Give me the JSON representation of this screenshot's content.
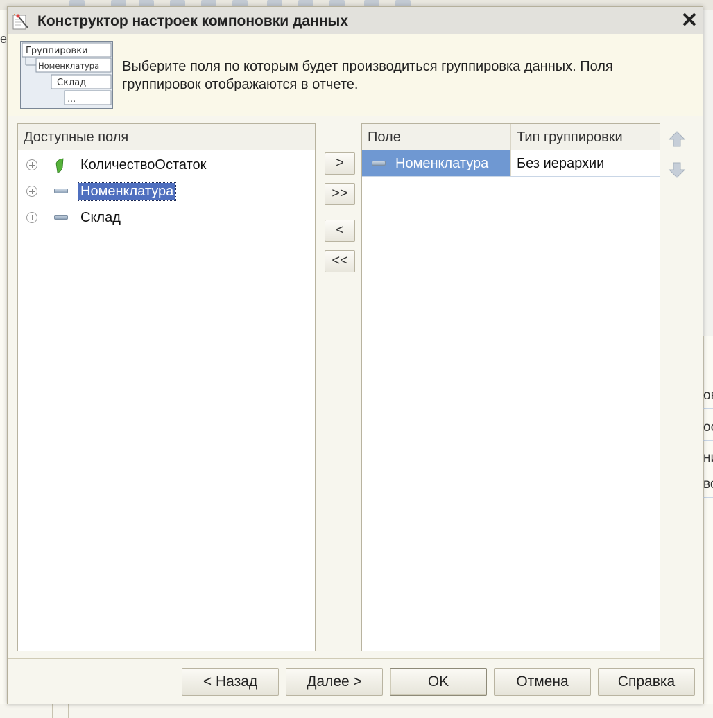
{
  "window": {
    "title": "Конструктор настроек компоновки данных",
    "close_icon": "close-icon"
  },
  "header": {
    "description": "Выберите поля по которым будет производиться группировка данных. Поля группировок отображаются в отчете.",
    "illustration": {
      "line1": "Группировки",
      "line2": "Номенклатура",
      "line3": "Склад",
      "line4": "..."
    }
  },
  "available_fields": {
    "header": "Доступные поля",
    "items": [
      {
        "label": "КоличествоОстаток",
        "icon": "resource-icon",
        "selected": false
      },
      {
        "label": "Номенклатура",
        "icon": "field-icon",
        "selected": true
      },
      {
        "label": "Склад",
        "icon": "field-icon",
        "selected": false
      }
    ]
  },
  "move_buttons": {
    "add": ">",
    "add_all": ">>",
    "remove": "<",
    "remove_all": "<<"
  },
  "grouping_table": {
    "columns": [
      "Поле",
      "Тип группировки"
    ],
    "rows": [
      {
        "field": "Номенклатура",
        "type": "Без иерархии"
      }
    ]
  },
  "footer": {
    "back": "< Назад",
    "next": "Далее >",
    "ok": "OK",
    "cancel": "Отмена",
    "help": "Справка"
  },
  "background": {
    "left_fragment": "е",
    "right_fragments": [
      "ов",
      "ос",
      "ни",
      "во"
    ]
  },
  "colors": {
    "selection": "#4f6fbf",
    "row_highlight": "#6f98d2",
    "dialog_bg": "#f7f6ee",
    "header_bg": "#faf8e9"
  }
}
